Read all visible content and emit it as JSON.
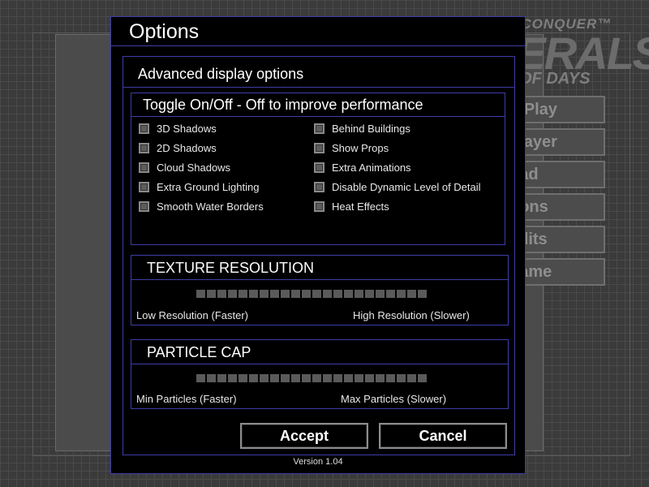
{
  "background": {
    "logo": {
      "line1": "COMMAND & CONQUER™",
      "line2": "GENERALS",
      "line3": "OF DAYS"
    },
    "menu": [
      {
        "label": "o Play"
      },
      {
        "label": "player"
      },
      {
        "label": "oad"
      },
      {
        "label": "tions"
      },
      {
        "label": "edits"
      },
      {
        "label": "game"
      }
    ]
  },
  "dialog": {
    "title": "Options",
    "advanced_title": "Advanced display options",
    "toggle_group": {
      "title": "Toggle On/Off - Off to improve performance",
      "left_options": [
        {
          "label": "3D Shadows",
          "checked": false
        },
        {
          "label": "2D Shadows",
          "checked": false
        },
        {
          "label": "Cloud Shadows",
          "checked": false
        },
        {
          "label": "Extra Ground Lighting",
          "checked": false
        },
        {
          "label": "Smooth Water Borders",
          "checked": false
        }
      ],
      "right_options": [
        {
          "label": "Behind Buildings",
          "checked": false
        },
        {
          "label": "Show Props",
          "checked": false
        },
        {
          "label": "Extra Animations",
          "checked": false
        },
        {
          "label": "Disable Dynamic Level of Detail",
          "checked": false
        },
        {
          "label": "Heat Effects",
          "checked": false
        }
      ]
    },
    "texture": {
      "title": "TEXTURE RESOLUTION",
      "min_label": "Low Resolution (Faster)",
      "max_label": "High Resolution (Slower)",
      "segments": 22,
      "level": 0
    },
    "particle": {
      "title": "PARTICLE CAP",
      "min_label": "Min Particles (Faster)",
      "max_label": "Max Particles (Slower)",
      "segments": 22,
      "level": 0
    },
    "accept_label": "Accept",
    "cancel_label": "Cancel",
    "version": "Version 1.04"
  }
}
